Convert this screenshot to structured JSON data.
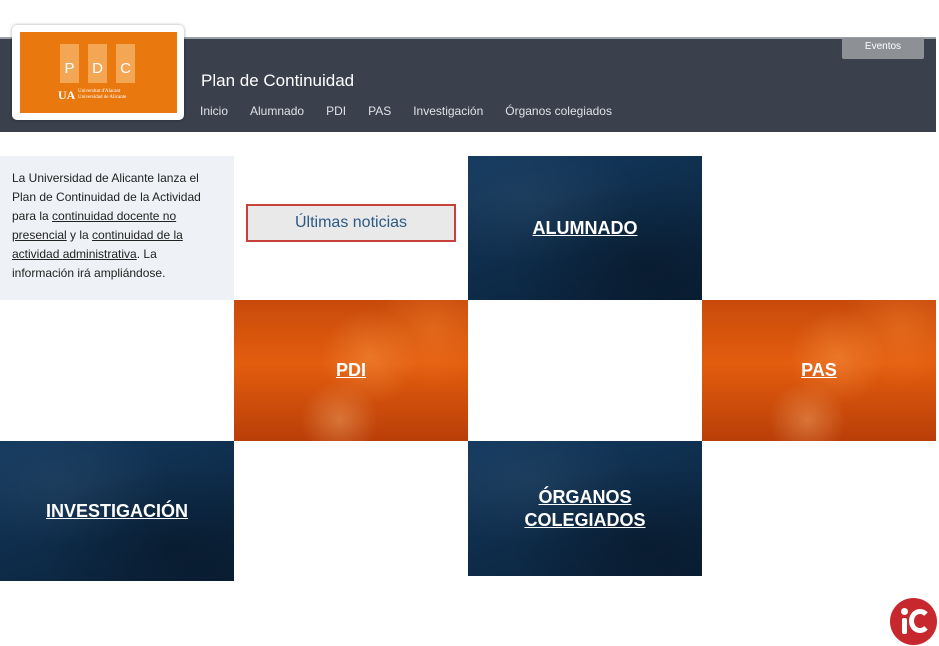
{
  "header": {
    "site_title": "Plan de Continuidad",
    "eventos_label": "Eventos",
    "nav": [
      "Inicio",
      "Alumnado",
      "PDI",
      "PAS",
      "Investigación",
      "Órganos colegiados"
    ],
    "bg_color": "#3a414c"
  },
  "logo": {
    "letters": [
      "P",
      "D",
      "C"
    ],
    "ua": "UA",
    "university_line1": "Universitat d'Alacant",
    "university_line2": "Universidad de Alicante",
    "color": "#e9790f"
  },
  "intro": {
    "text1": "La Universidad de Alicante lanza el Plan de Continuidad de la Actividad para la ",
    "link1": "continuidad docente no presencial",
    "text2": " y la ",
    "link2": "continuidad de la actividad administrativa",
    "text3": ". La información irá ampliándose."
  },
  "news_button": "Últimas noticias",
  "tiles": {
    "alumnado": "ALUMNADO",
    "pdi": "PDI",
    "pas": "PAS",
    "investigacion": "INVESTIGACIÓN",
    "organos_line1": "ÓRGANOS",
    "organos_line2": "COLEGIADOS"
  },
  "colors": {
    "tile_blue": "#0e2c4a",
    "tile_orange": "#e35d0e",
    "news_border": "#c9413b",
    "ic_red": "#c7282e"
  },
  "icons": {
    "corner_logo": "ic-logo-icon"
  }
}
